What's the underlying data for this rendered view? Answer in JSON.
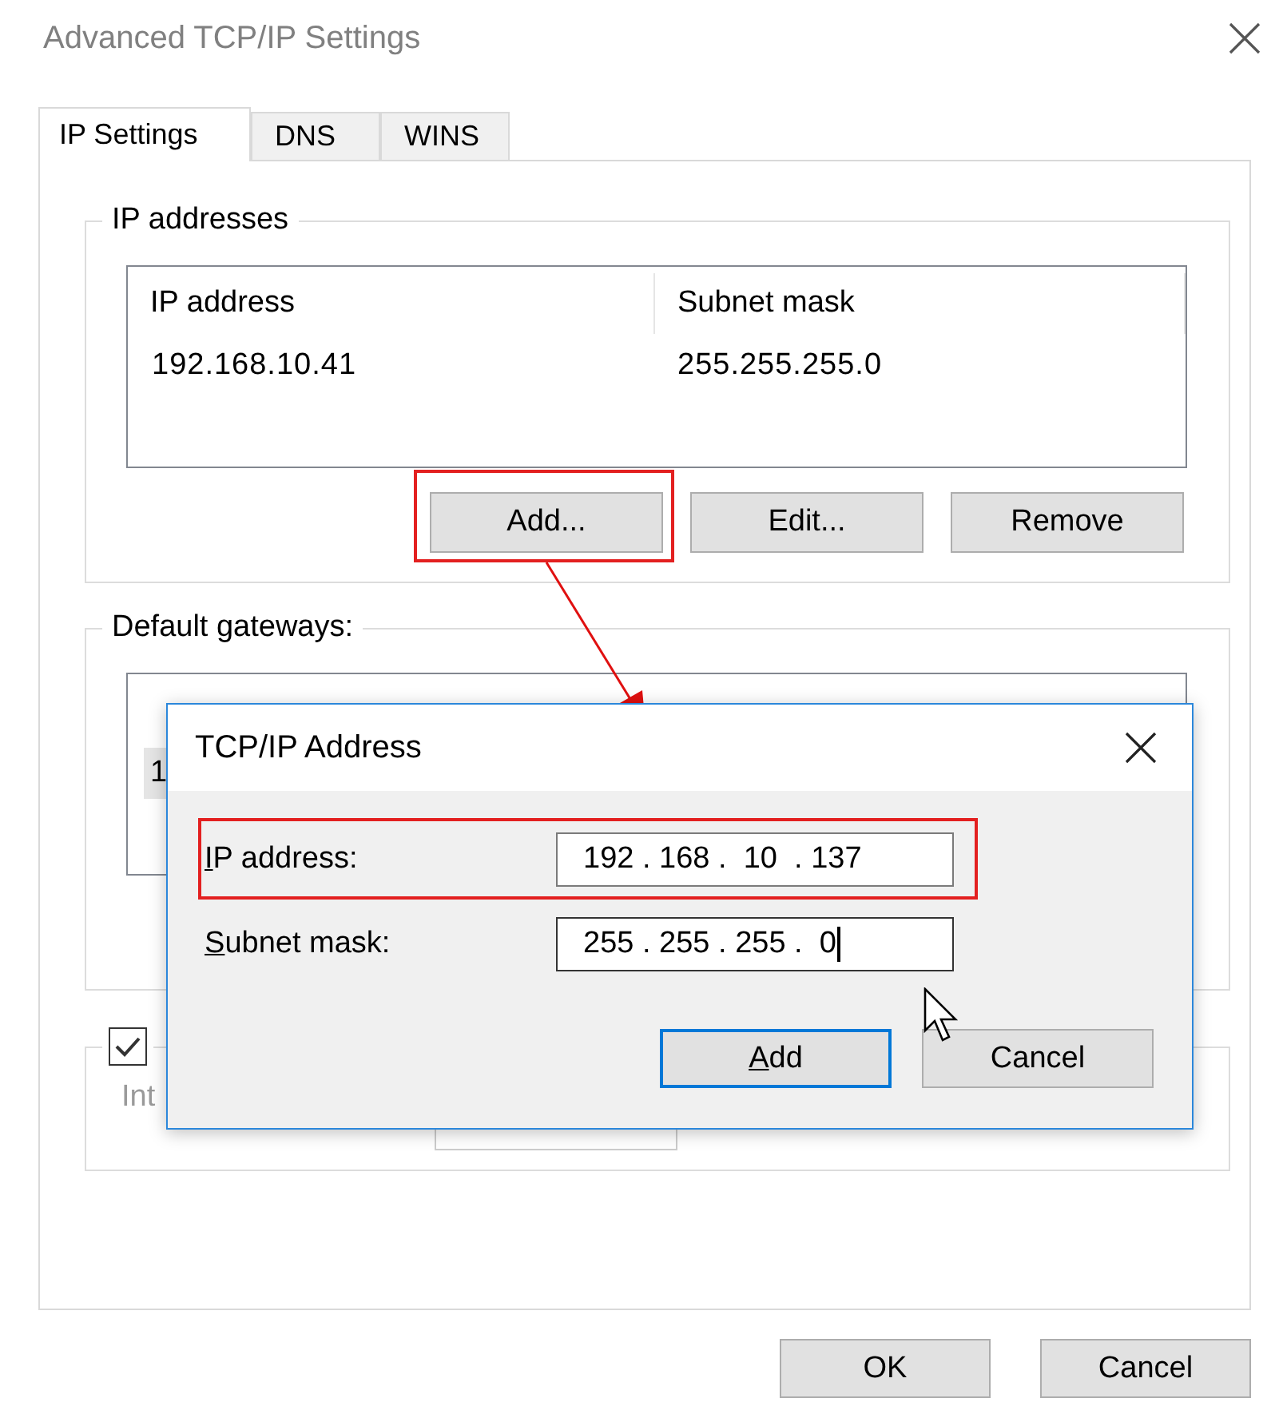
{
  "window": {
    "title": "Advanced TCP/IP Settings"
  },
  "tabs": [
    {
      "label": "IP Settings",
      "selected": true
    },
    {
      "label": "DNS",
      "selected": false
    },
    {
      "label": "WINS",
      "selected": false
    }
  ],
  "ip_addresses": {
    "title": "IP addresses",
    "columns": [
      "IP address",
      "Subnet mask"
    ],
    "rows": [
      [
        "192.168.10.41",
        "255.255.255.0"
      ]
    ],
    "buttons": [
      {
        "label": "Add...",
        "highlighted": true
      },
      {
        "label": "Edit...",
        "highlighted": false
      },
      {
        "label": "Remove",
        "highlighted": false
      }
    ]
  },
  "default_gateways": {
    "title": "Default gateways:",
    "rows": [
      {
        "column_1": "1",
        "selected": true
      }
    ]
  },
  "metric": {
    "checked": true,
    "label": "Int"
  },
  "buttons": [
    "OK",
    "Cancel"
  ],
  "popup": {
    "title": "TCP/IP Address",
    "fields": [
      {
        "label": "IP address:",
        "value": "192 . 168 .  10  . 137",
        "highlighted": true,
        "focused": false
      },
      {
        "label": "Subnet mask:",
        "value": "255 . 255 . 255 .  0",
        "highlighted": false,
        "focused": true
      }
    ],
    "buttons": [
      {
        "label": "Add",
        "default": true
      },
      {
        "label": "Cancel",
        "default": false
      }
    ]
  }
}
